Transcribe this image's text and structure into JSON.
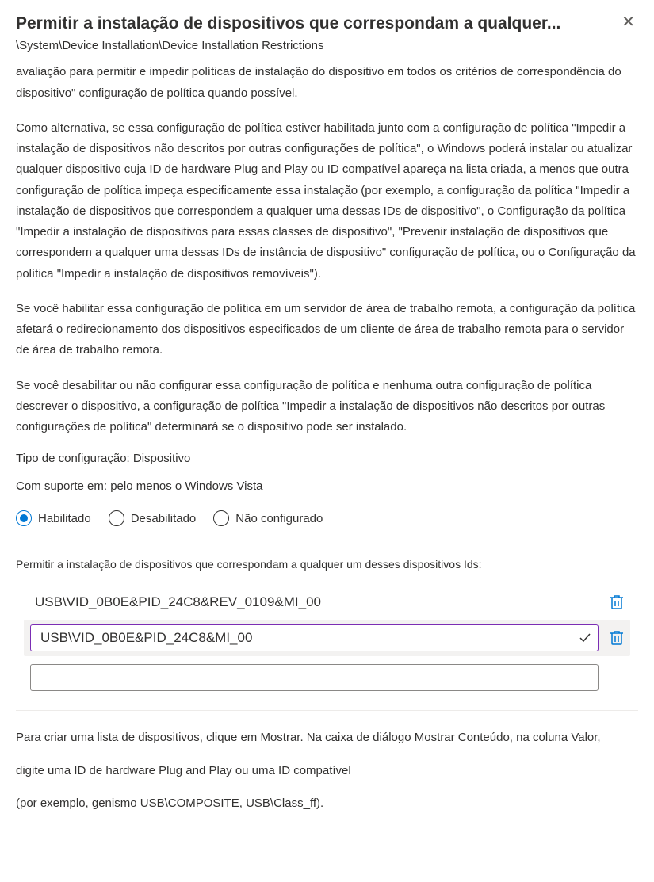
{
  "header": {
    "title": "Permitir a instalação de dispositivos que correspondam a qualquer...",
    "breadcrumb": "\\System\\Device Installation\\Device Installation Restrictions"
  },
  "description": {
    "p1": "avaliação para permitir e impedir políticas de instalação do dispositivo em todos os critérios de correspondência do dispositivo\" configuração de política quando possível.",
    "p2": "Como alternativa, se essa configuração de política estiver habilitada junto com a configuração de política \"Impedir a instalação de dispositivos não descritos por outras configurações de política\", o Windows poderá instalar ou atualizar qualquer dispositivo cuja ID de hardware Plug and Play ou ID compatível apareça na lista criada, a menos que outra configuração de política impeça especificamente essa instalação (por exemplo, a configuração da política \"Impedir a instalação de dispositivos que correspondem a qualquer uma dessas IDs de dispositivo\", o Configuração da política \"Impedir a instalação de dispositivos para essas classes de dispositivo\", \"Prevenir instalação de dispositivos que correspondem a qualquer uma dessas IDs de instância de dispositivo\" configuração de política, ou o Configuração da política \"Impedir a instalação de dispositivos removíveis\").",
    "p3": "Se você habilitar essa configuração de política em um servidor de área de trabalho remota, a configuração da política afetará o redirecionamento dos dispositivos especificados de um cliente de área de trabalho remota para o servidor de área de trabalho remota.",
    "p4": "Se você desabilitar ou não configurar essa configuração de política e nenhuma outra configuração de política descrever o dispositivo, a configuração de política \"Impedir a instalação de dispositivos não descritos por outras configurações de política\" determinará se o dispositivo pode ser instalado."
  },
  "meta": {
    "setting_type": "Tipo de configuração: Dispositivo",
    "supported_on": "Com suporte em: pelo menos o Windows Vista"
  },
  "radios": {
    "enabled": "Habilitado",
    "disabled": "Desabilitado",
    "not_configured": "Não configurado",
    "selected": "enabled"
  },
  "list": {
    "label": "Permitir a instalação de dispositivos que correspondam a qualquer um desses dispositivos Ids:",
    "items": [
      {
        "value": "USB\\VID_0B0E&PID_24C8&REV_0109&MI_00",
        "editing": false
      },
      {
        "value": "USB\\VID_0B0E&PID_24C8&MI_00",
        "editing": true
      }
    ],
    "new_value": ""
  },
  "footer": {
    "p1": "Para criar uma lista de dispositivos, clique em Mostrar. Na caixa de diálogo Mostrar Conteúdo, na coluna Valor,",
    "p2": "digite uma ID de hardware Plug and Play ou uma ID compatível",
    "p3": "(por exemplo, genismo USB\\COMPOSITE, USB\\Class_ff)."
  },
  "icons": {
    "close": "close-icon",
    "trash": "trash-icon",
    "check": "check-icon"
  }
}
